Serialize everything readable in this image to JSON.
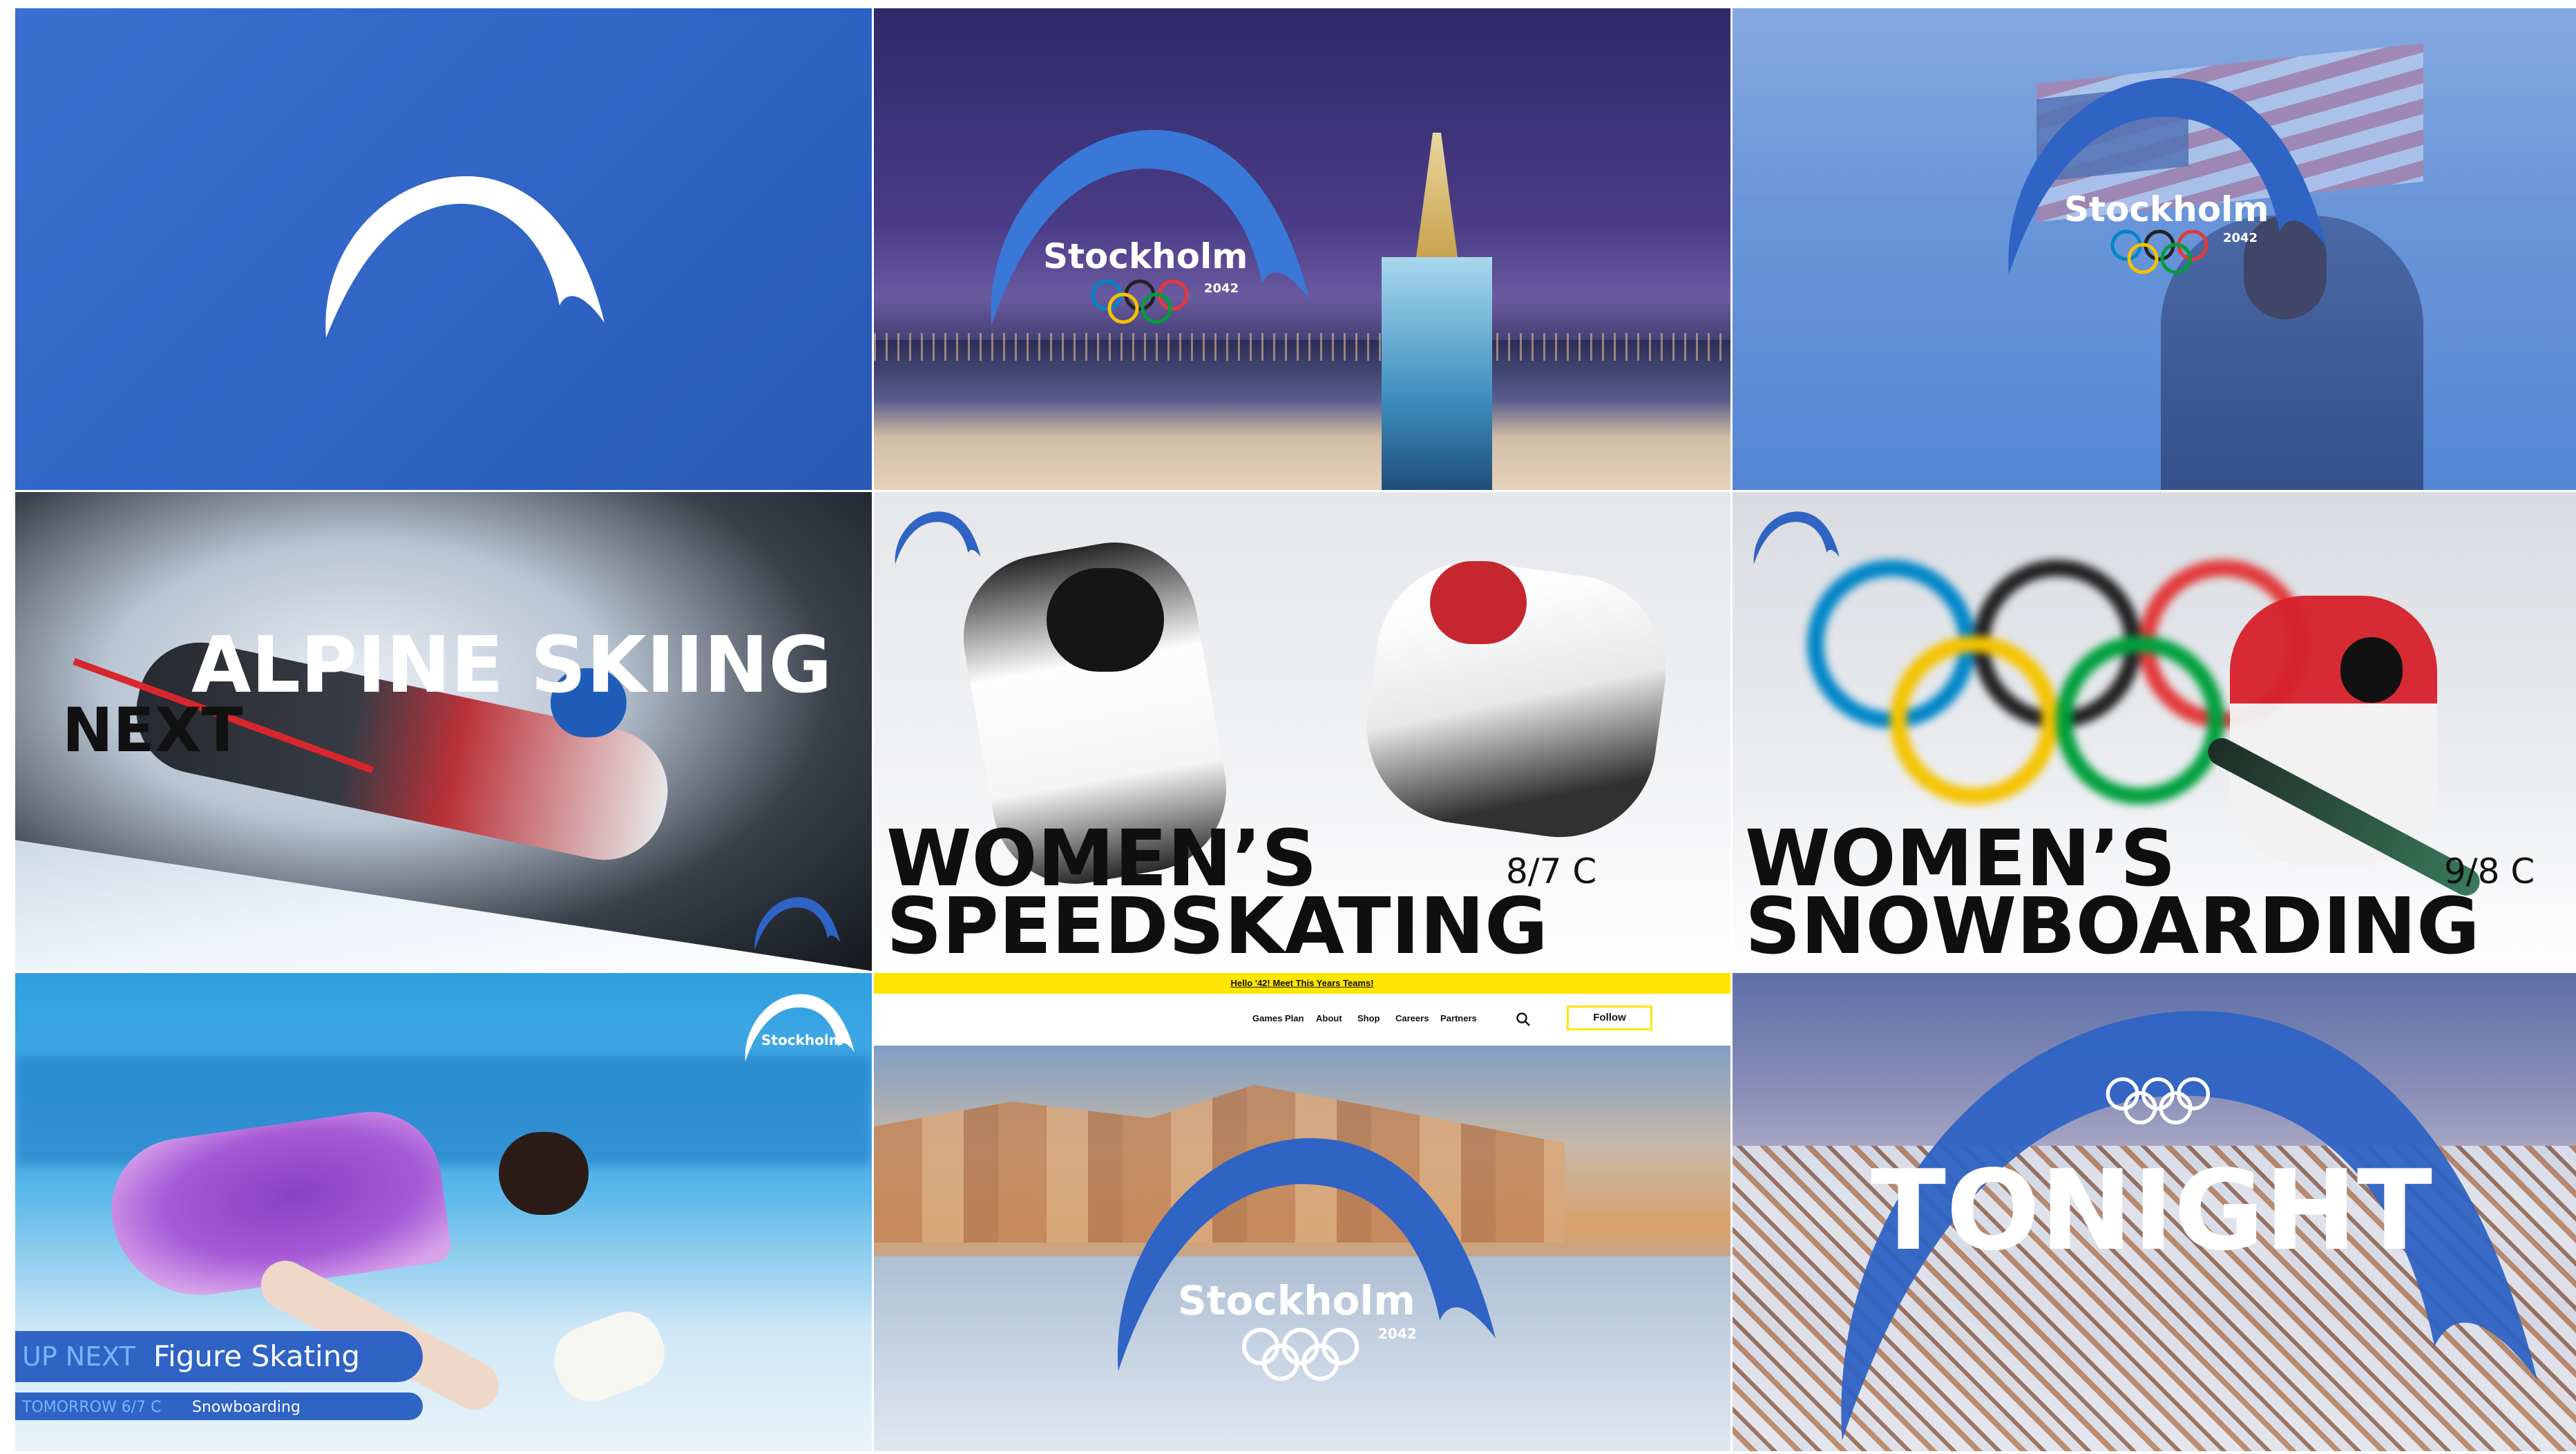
{
  "brand": {
    "city": "Stockholm",
    "year": "2042",
    "accent": "#2f63c4",
    "ring_colors": [
      "#0085c7",
      "#222222",
      "#e23a3a",
      "#f4c300",
      "#009f3d"
    ]
  },
  "tiles": {
    "alpine": {
      "title": "ALPINE SKIING",
      "label": "NEXT"
    },
    "speed": {
      "line1": "WOMEN’S",
      "line2": "SPEEDSKATING",
      "date": "8/7 C"
    },
    "snow": {
      "line1": "WOMEN’S",
      "line2": "SNOWBOARDING",
      "date": "9/8 C"
    },
    "figure": {
      "upnext_label": "UP NEXT",
      "upnext_event": "Figure Skating",
      "tomorrow_label": "TOMORROW 6/7 C",
      "tomorrow_event": "Snowboarding"
    },
    "web": {
      "banner": "Hello '42! Meet This Years Teams!",
      "nav": [
        "Games Plan",
        "About",
        "Shop",
        "Careers",
        "Partners"
      ],
      "follow_label": "Follow"
    },
    "tonight": {
      "title": "TONIGHT"
    }
  }
}
